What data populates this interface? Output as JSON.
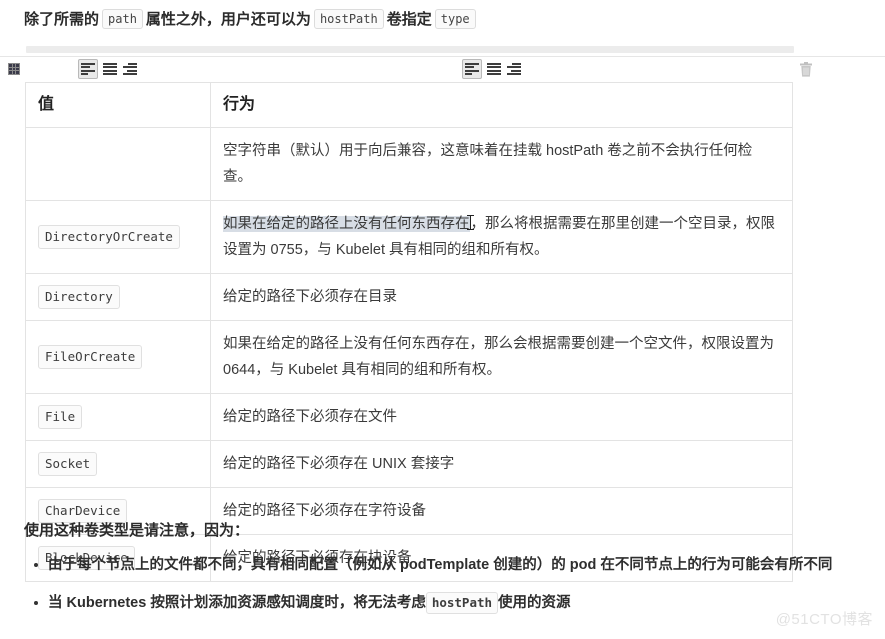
{
  "intro": {
    "part1": "除了所需的",
    "chip1": "path",
    "part2": "属性之外，用户还可以为",
    "chip2": "hostPath",
    "part3": "卷指定",
    "chip3": "type"
  },
  "toolbar": {
    "grid_label": "表格",
    "align_left_label": "左对齐",
    "align_center_label": "居中对齐",
    "align_right_label": "右对齐",
    "delete_label": "删除"
  },
  "table": {
    "headers": [
      "值",
      "行为"
    ],
    "rows": [
      {
        "value": "",
        "behavior_selected": "",
        "behavior": "空字符串（默认）用于向后兼容，这意味着在挂载 hostPath 卷之前不会执行任何检查。"
      },
      {
        "value": "DirectoryOrCreate",
        "behavior_selected": "如果在给定的路径上没有任何东西存在",
        "behavior": "，那么将根据需要在那里创建一个空目录，权限设置为 0755，与 Kubelet 具有相同的组和所有权。"
      },
      {
        "value": "Directory",
        "behavior_selected": "",
        "behavior": "给定的路径下必须存在目录"
      },
      {
        "value": "FileOrCreate",
        "behavior_selected": "",
        "behavior": "如果在给定的路径上没有任何东西存在，那么会根据需要创建一个空文件，权限设置为 0644，与 Kubelet 具有相同的组和所有权。"
      },
      {
        "value": "File",
        "behavior_selected": "",
        "behavior": "给定的路径下必须存在文件"
      },
      {
        "value": "Socket",
        "behavior_selected": "",
        "behavior": "给定的路径下必须存在 UNIX 套接字"
      },
      {
        "value": "CharDevice",
        "behavior_selected": "",
        "behavior": "给定的路径下必须存在字符设备"
      },
      {
        "value": "BlockDevice",
        "behavior_selected": "",
        "behavior": "给定的路径下必须存在块设备"
      }
    ]
  },
  "note": "使用这种卷类型是请注意，因为：",
  "bullets": [
    {
      "text": "由于每个节点上的文件都不同，具有相同配置（例如从 podTemplate 创建的）的 pod 在不同节点上的行为可能会有所不同",
      "chip": "",
      "text_after": ""
    },
    {
      "text": "当 Kubernetes 按照计划添加资源感知调度时，将无法考虑",
      "chip": "hostPath",
      "text_after": "使用的资源"
    }
  ],
  "watermark": "@51CTO博客",
  "colors": {
    "border": "#e3e3e3",
    "chip_bg": "#fbfbfb",
    "selection": "#d7dde5",
    "toolbar_active": "#e9e9e9"
  }
}
